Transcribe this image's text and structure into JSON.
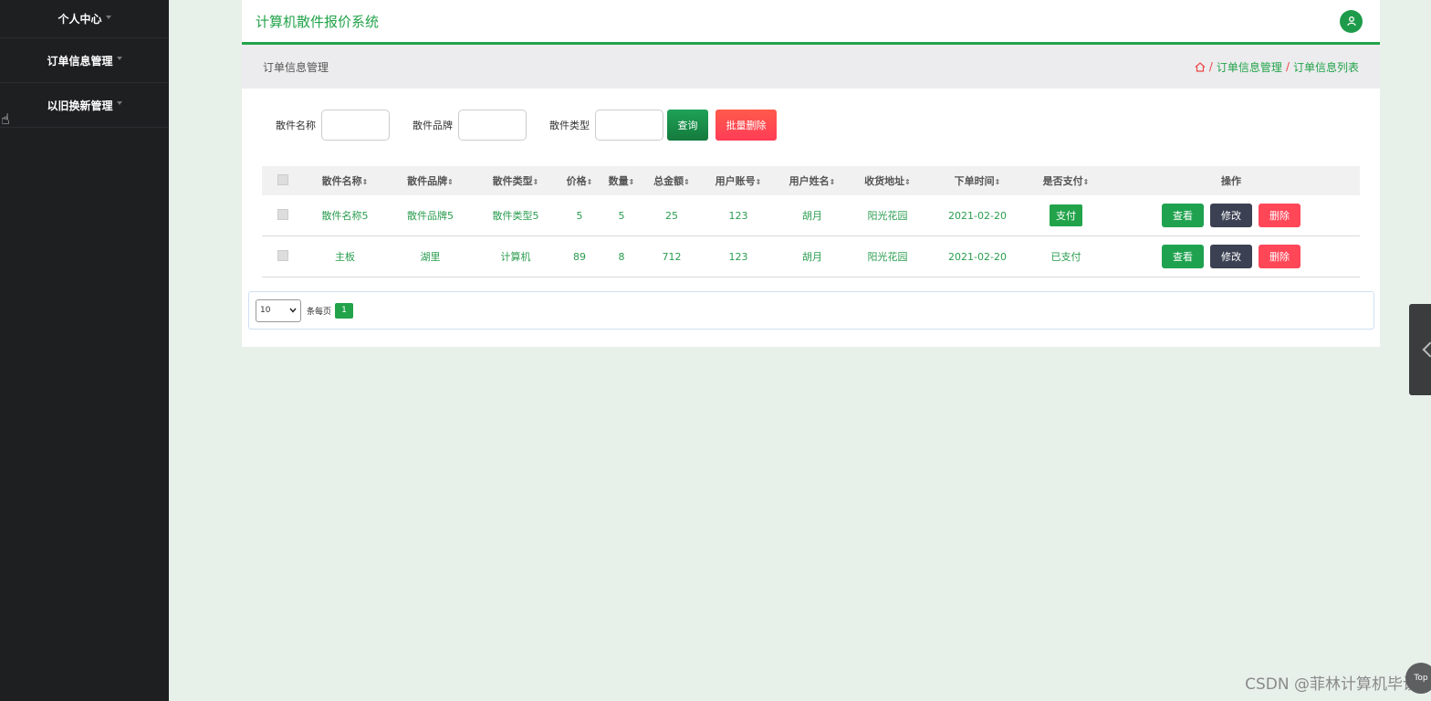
{
  "sidebar": {
    "items": [
      {
        "label": "个人中心"
      },
      {
        "label": "订单信息管理"
      },
      {
        "label": "以旧换新管理"
      }
    ]
  },
  "header": {
    "app_title": "计算机散件报价系统"
  },
  "breadcrumb": {
    "page_title": "订单信息管理",
    "crumb1": "订单信息管理",
    "crumb2": "订单信息列表",
    "sep": "/"
  },
  "search": {
    "label_name": "散件名称",
    "label_brand": "散件品牌",
    "label_type": "散件类型",
    "query_btn": "查询",
    "batch_delete_btn": "批量删除"
  },
  "table": {
    "headers": [
      "散件名称",
      "散件品牌",
      "散件类型",
      "价格",
      "数量",
      "总金额",
      "用户账号",
      "用户姓名",
      "收货地址",
      "下单时间",
      "是否支付",
      "操作"
    ],
    "sort_glyph": "⇕",
    "rows": [
      {
        "name": "散件名称5",
        "brand": "散件品牌5",
        "type": "散件类型5",
        "price": "5",
        "qty": "5",
        "total": "25",
        "account": "123",
        "user": "胡月",
        "address": "阳光花园",
        "date": "2021-02-20",
        "paid": "支付",
        "paid_is_button": true
      },
      {
        "name": "主板",
        "brand": "湖里",
        "type": "计算机",
        "price": "89",
        "qty": "8",
        "total": "712",
        "account": "123",
        "user": "胡月",
        "address": "阳光花园",
        "date": "2021-02-20",
        "paid": "已支付",
        "paid_is_button": false
      }
    ],
    "actions": {
      "view": "查看",
      "edit": "修改",
      "delete": "删除"
    }
  },
  "pager": {
    "page_size": "10",
    "per_page_label": "条每页",
    "current_page": "1"
  },
  "watermark": "CSDN @菲林计算机毕设",
  "top_button": "Top",
  "colors": {
    "accent": "#22a34a",
    "danger": "#ff4758",
    "dark": "#3b4152",
    "sidebar_bg": "#1e1f21"
  }
}
